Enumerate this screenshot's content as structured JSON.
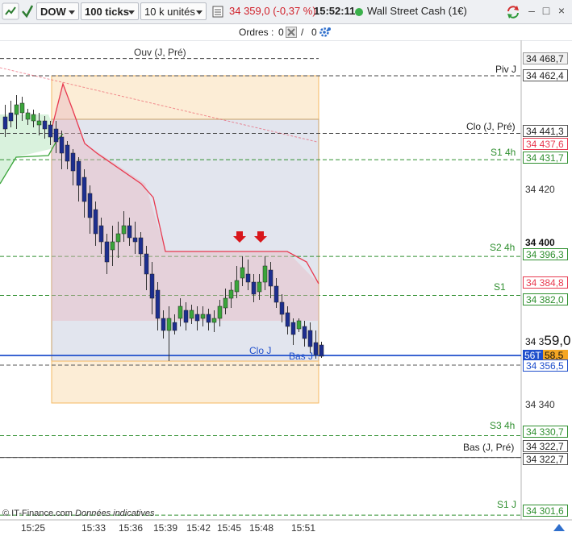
{
  "toolbar": {
    "instrument": "DOW",
    "ticks": "100 ticks",
    "units": "10 k unités",
    "price_change": "34 359,0 (-0,37 %)",
    "clock": "15:52:11",
    "market_name": "Wall Street Cash (1€)",
    "minimize": "–",
    "maximize": "□",
    "close": "×"
  },
  "orders": {
    "label": "Ordres :",
    "count1": "0",
    "count2": "0"
  },
  "chart_data": {
    "type": "candlestick",
    "levels": [
      {
        "name": "Ouv (J, Pré)",
        "price": "34 468,7"
      },
      {
        "name": "Piv J",
        "price": "34 462,4"
      },
      {
        "name": "Clo (J, Pré)",
        "price": "34 441,3"
      },
      {
        "name": "S1 4h",
        "price": "34 431,7"
      },
      {
        "name": "S2 4h",
        "price": "34 396,3"
      },
      {
        "name": "S1",
        "price": "34 382,0"
      },
      {
        "name": "Clo J",
        "price": "34 359,0"
      },
      {
        "name": "Bas J",
        "price": "34 356,5"
      },
      {
        "name": "S3 4h",
        "price": "34 330,7"
      },
      {
        "name": "Bas (J, Pré)",
        "price": "34 322,7"
      },
      {
        "name": "S1 J",
        "price": "34 301,6"
      }
    ],
    "yaxis_ticks": [
      "34 420",
      "34 400",
      "34 340"
    ],
    "other_prices": [
      "34 437,6",
      "34 384,8"
    ],
    "current_price": "34 359,0",
    "current_price_big": "59,0",
    "current_price_small": "34 3",
    "spread_label": "56T",
    "bid": "58,5",
    "xaxis_ticks": [
      "15:25",
      "15:33",
      "15:36",
      "15:39",
      "15:42",
      "15:45",
      "15:48",
      "15:51"
    ],
    "source_note": "© IT-Finance.com",
    "source_note2": "Données indicatives",
    "colors": {
      "up": "#3aa53a",
      "down": "#1c2e8f",
      "cursor": "#1f4fcc",
      "resistance": "#e8394f",
      "support": "#2f8f2f"
    }
  }
}
